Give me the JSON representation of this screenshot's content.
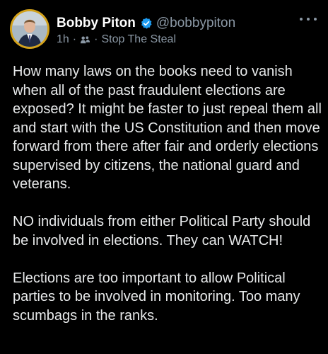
{
  "post": {
    "author": {
      "display_name": "Bobby Piton",
      "handle": "@bobbypiton",
      "verified": true
    },
    "meta": {
      "time": "1h",
      "separator": "·",
      "community_icon": "community-icon",
      "community": "Stop The Steal"
    },
    "paragraphs": [
      "How many laws on the books need to vanish when all of the past fraudulent elections are exposed? It might be faster to just repeal them all and start with the US Constitution and then move forward from there after fair and orderly elections supervised by citizens, the national guard and veterans.",
      "NO individuals from either Political Party should be involved in elections. They can WATCH!",
      "Elections are too important to allow Political parties to be involved in monitoring. Too many scumbags in the ranks."
    ]
  },
  "colors": {
    "background": "#000000",
    "text": "#e7e9ea",
    "secondary_text": "#8b98a5",
    "verified_badge": "#1d9bf0",
    "avatar_ring": "#d4a21a"
  }
}
